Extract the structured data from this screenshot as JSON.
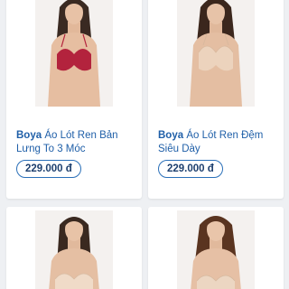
{
  "products": [
    {
      "brand": "Boya",
      "name": "Áo Lót Ren Bản Lưng To 3 Móc",
      "price": "229.000 đ",
      "bra_color": "#b3233d"
    },
    {
      "brand": "Boya",
      "name": "Áo Lót Ren Đệm Siêu Dày",
      "price": "229.000 đ",
      "bra_color": "#ecd3bd"
    },
    {
      "bra_color": "#f0dbc8"
    },
    {
      "bra_color": "#ecd6c2"
    }
  ],
  "colors": {
    "title": "#1f5fa8",
    "price_border": "#2a6fb8",
    "background": "#eef0f3"
  }
}
